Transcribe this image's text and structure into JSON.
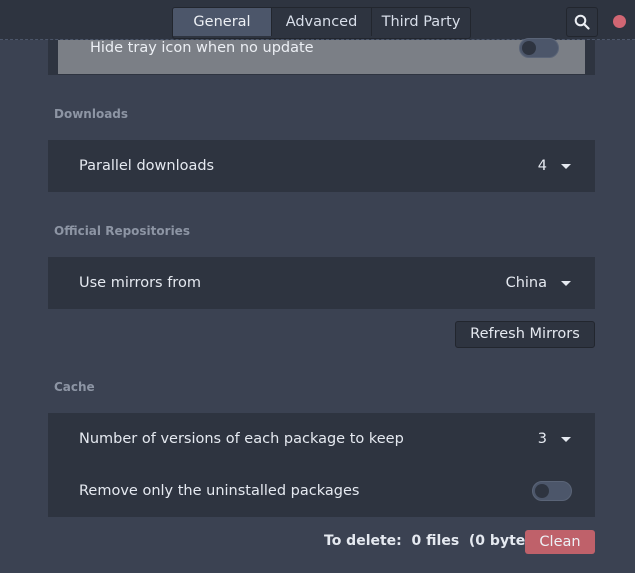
{
  "tabs": [
    {
      "label": "General",
      "active": true
    },
    {
      "label": "Advanced",
      "active": false
    },
    {
      "label": "Third Party",
      "active": false
    }
  ],
  "header_icons": {
    "search": "search-icon",
    "close": "close-dot-icon"
  },
  "tray": {
    "label": "Hide tray icon when no update",
    "enabled": false
  },
  "downloads": {
    "section_title": "Downloads",
    "parallel_label": "Parallel downloads",
    "parallel_value": "4"
  },
  "official_repos": {
    "section_title": "Official Repositories",
    "mirrors_label": "Use mirrors from",
    "mirrors_value": "China",
    "refresh_label": "Refresh Mirrors"
  },
  "cache": {
    "section_title": "Cache",
    "keep_label": "Number of versions of each package to keep",
    "keep_value": "3",
    "uninstalled_label": "Remove only the uninstalled packages",
    "uninstalled_enabled": false,
    "to_delete_label": "To delete:",
    "files": "0 files",
    "bytes": "(0 bytes)",
    "clean_label": "Clean"
  },
  "colors": {
    "background": "#3b4252",
    "card": "#2e3440",
    "active_tab": "#4c566a",
    "danger": "#bf616a",
    "close": "#d16673"
  }
}
